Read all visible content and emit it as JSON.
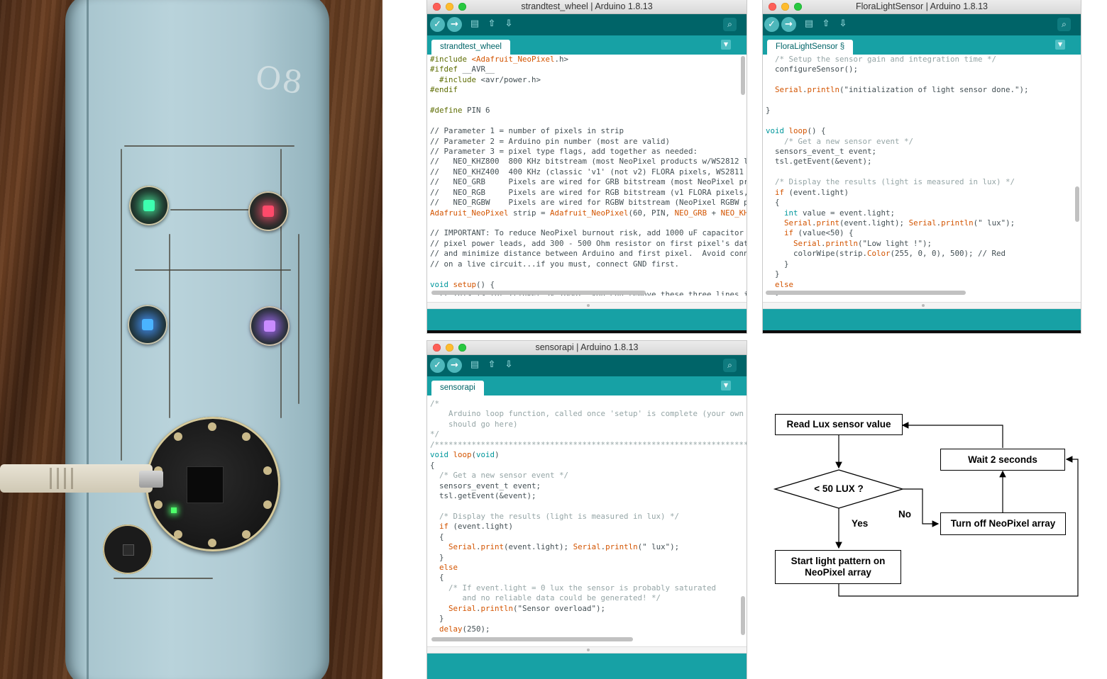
{
  "photo": {
    "signature_text": "O8"
  },
  "windows": {
    "strandtest": {
      "title": "strandtest_wheel | Arduino 1.8.13",
      "tab": "strandtest_wheel",
      "lines": [
        [
          [
            "c-dir",
            "#include "
          ],
          [
            "c-lib",
            "<Adafruit_NeoPixel"
          ],
          [
            "",
            "."
          ],
          [
            "",
            "h>"
          ]
        ],
        [
          [
            "c-dir",
            "#ifdef "
          ],
          [
            "",
            "__AVR__"
          ]
        ],
        [
          [
            "c-dir",
            "  #include "
          ],
          [
            "",
            "<avr/power.h>"
          ]
        ],
        [
          [
            "c-dir",
            "#endif"
          ]
        ],
        [
          [
            "",
            ""
          ]
        ],
        [
          [
            "c-dir",
            "#define "
          ],
          [
            "",
            "PIN 6"
          ]
        ],
        [
          [
            "",
            ""
          ]
        ],
        [
          [
            "",
            "// Parameter 1 = number of pixels in strip"
          ]
        ],
        [
          [
            "",
            "// Parameter 2 = Arduino pin number (most are valid)"
          ]
        ],
        [
          [
            "",
            "// Parameter 3 = pixel type flags, add together as needed:"
          ]
        ],
        [
          [
            "",
            "//   NEO_KHZ800  800 KHz bitstream (most NeoPixel products w/WS2812 l"
          ]
        ],
        [
          [
            "",
            "//   NEO_KHZ400  400 KHz (classic 'v1' (not v2) FLORA pixels, WS2811"
          ]
        ],
        [
          [
            "",
            "//   NEO_GRB     Pixels are wired for GRB bitstream (most NeoPixel pr"
          ]
        ],
        [
          [
            "",
            "//   NEO_RGB     Pixels are wired for RGB bitstream (v1 FLORA pixels,"
          ]
        ],
        [
          [
            "",
            "//   NEO_RGBW    Pixels are wired for RGBW bitstream (NeoPixel RGBW p"
          ]
        ],
        [
          [
            "c-kw",
            "Adafruit_NeoPixel"
          ],
          [
            "",
            " strip = "
          ],
          [
            "c-kw",
            "Adafruit_NeoPixel"
          ],
          [
            "",
            "(60, PIN, "
          ],
          [
            "c-kw",
            "NEO_GRB"
          ],
          [
            "",
            " + "
          ],
          [
            "c-kw",
            "NEO_KH"
          ]
        ],
        [
          [
            "",
            ""
          ]
        ],
        [
          [
            "",
            "// IMPORTANT: To reduce NeoPixel burnout risk, add 1000 uF capacitor"
          ]
        ],
        [
          [
            "",
            "// pixel power leads, add 300 - 500 Ohm resistor on first pixel's dat"
          ]
        ],
        [
          [
            "",
            "// and minimize distance between Arduino and first pixel.  Avoid conn"
          ]
        ],
        [
          [
            "",
            "// on a live circuit...if you must, connect GND first."
          ]
        ],
        [
          [
            "",
            ""
          ]
        ],
        [
          [
            "c-ty",
            "void "
          ],
          [
            "c-kw",
            "setup"
          ],
          [
            "",
            "() {"
          ]
        ],
        [
          [
            "",
            "  // This is for Trinket 5V 16MHz, you can remove these three lines i"
          ]
        ]
      ]
    },
    "flora": {
      "title": "FloraLightSensor | Arduino 1.8.13",
      "tab": "FloraLightSensor §",
      "lines": [
        [
          [
            "c-cm",
            "  /* Setup the sensor gain and integration time */"
          ]
        ],
        [
          [
            "",
            "  configureSensor();"
          ]
        ],
        [
          [
            "",
            ""
          ]
        ],
        [
          [
            "c-kw",
            "  Serial"
          ],
          [
            "",
            "."
          ],
          [
            "c-kw",
            "println"
          ],
          [
            "",
            "(\"initialization of light sensor done.\");"
          ]
        ],
        [
          [
            "",
            ""
          ]
        ],
        [
          [
            "",
            "}"
          ]
        ],
        [
          [
            "",
            ""
          ]
        ],
        [
          [
            "c-ty",
            "void "
          ],
          [
            "c-kw",
            "loop"
          ],
          [
            "",
            "() {"
          ]
        ],
        [
          [
            "c-cm",
            "    /* Get a new sensor event */"
          ]
        ],
        [
          [
            "",
            "  sensors_event_t event;"
          ]
        ],
        [
          [
            "",
            "  tsl.getEvent(&event);"
          ]
        ],
        [
          [
            "",
            ""
          ]
        ],
        [
          [
            "c-cm",
            "  /* Display the results (light is measured in lux) */"
          ]
        ],
        [
          [
            "c-kw",
            "  if"
          ],
          [
            "",
            " (event.light)"
          ]
        ],
        [
          [
            "",
            "  {"
          ]
        ],
        [
          [
            "c-ty",
            "    int"
          ],
          [
            "",
            " value = event.light;"
          ]
        ],
        [
          [
            "c-kw",
            "    Serial"
          ],
          [
            "",
            "."
          ],
          [
            "c-kw",
            "print"
          ],
          [
            "",
            "(event.light); "
          ],
          [
            "c-kw",
            "Serial"
          ],
          [
            "",
            "."
          ],
          [
            "c-kw",
            "println"
          ],
          [
            "",
            "(\" lux\");"
          ]
        ],
        [
          [
            "c-kw",
            "    if"
          ],
          [
            "",
            " (value<50) {"
          ]
        ],
        [
          [
            "c-kw",
            "      Serial"
          ],
          [
            "",
            "."
          ],
          [
            "c-kw",
            "println"
          ],
          [
            "",
            "(\"Low light !\");"
          ]
        ],
        [
          [
            "",
            "      colorWipe(strip."
          ],
          [
            "c-kw",
            "Color"
          ],
          [
            "",
            "(255, 0, 0), 500); // Red"
          ]
        ],
        [
          [
            "",
            "    }"
          ]
        ],
        [
          [
            "",
            "  }"
          ]
        ],
        [
          [
            "c-kw",
            "  else"
          ]
        ],
        [
          [
            "",
            "  {"
          ]
        ]
      ]
    },
    "sensorapi": {
      "title": "sensorapi | Arduino 1.8.13",
      "tab": "sensorapi",
      "lines": [
        [
          [
            "c-cm",
            "/*"
          ]
        ],
        [
          [
            "c-cm",
            "    Arduino loop function, called once 'setup' is complete (your own"
          ]
        ],
        [
          [
            "c-cm",
            "    should go here)"
          ]
        ],
        [
          [
            "c-cm",
            "*/"
          ]
        ],
        [
          [
            "c-cm",
            "/**************************************************************************"
          ]
        ],
        [
          [
            "c-ty",
            "void "
          ],
          [
            "c-kw",
            "loop"
          ],
          [
            "",
            "("
          ],
          [
            "c-ty",
            "void"
          ],
          [
            "",
            ")"
          ]
        ],
        [
          [
            "",
            "{"
          ]
        ],
        [
          [
            "c-cm",
            "  /* Get a new sensor event */"
          ]
        ],
        [
          [
            "",
            "  sensors_event_t event;"
          ]
        ],
        [
          [
            "",
            "  tsl.getEvent(&event);"
          ]
        ],
        [
          [
            "",
            ""
          ]
        ],
        [
          [
            "c-cm",
            "  /* Display the results (light is measured in lux) */"
          ]
        ],
        [
          [
            "c-kw",
            "  if"
          ],
          [
            "",
            " (event.light)"
          ]
        ],
        [
          [
            "",
            "  {"
          ]
        ],
        [
          [
            "c-kw",
            "    Serial"
          ],
          [
            "",
            "."
          ],
          [
            "c-kw",
            "print"
          ],
          [
            "",
            "(event.light); "
          ],
          [
            "c-kw",
            "Serial"
          ],
          [
            "",
            "."
          ],
          [
            "c-kw",
            "println"
          ],
          [
            "",
            "(\" lux\");"
          ]
        ],
        [
          [
            "",
            "  }"
          ]
        ],
        [
          [
            "c-kw",
            "  else"
          ]
        ],
        [
          [
            "",
            "  {"
          ]
        ],
        [
          [
            "c-cm",
            "    /* If event.light = 0 lux the sensor is probably saturated"
          ]
        ],
        [
          [
            "c-cm",
            "       and no reliable data could be generated! */"
          ]
        ],
        [
          [
            "c-kw",
            "    Serial"
          ],
          [
            "",
            "."
          ],
          [
            "c-kw",
            "println"
          ],
          [
            "",
            "(\"Sensor overload\");"
          ]
        ],
        [
          [
            "",
            "  }"
          ]
        ],
        [
          [
            "c-kw",
            "  delay"
          ],
          [
            "",
            "(250);"
          ]
        ]
      ]
    }
  },
  "flowchart": {
    "read": "Read Lux sensor value",
    "decision": "< 50 LUX ?",
    "yes": "Yes",
    "no": "No",
    "start": "Start light pattern on NeoPixel array",
    "off": "Turn off NeoPixel array",
    "wait": "Wait 2 seconds"
  },
  "colors": {
    "toolbar": "#006468",
    "tabbar": "#17a1a5",
    "keyword": "#d35400",
    "type": "#00979c",
    "comment": "#95a5a6"
  }
}
